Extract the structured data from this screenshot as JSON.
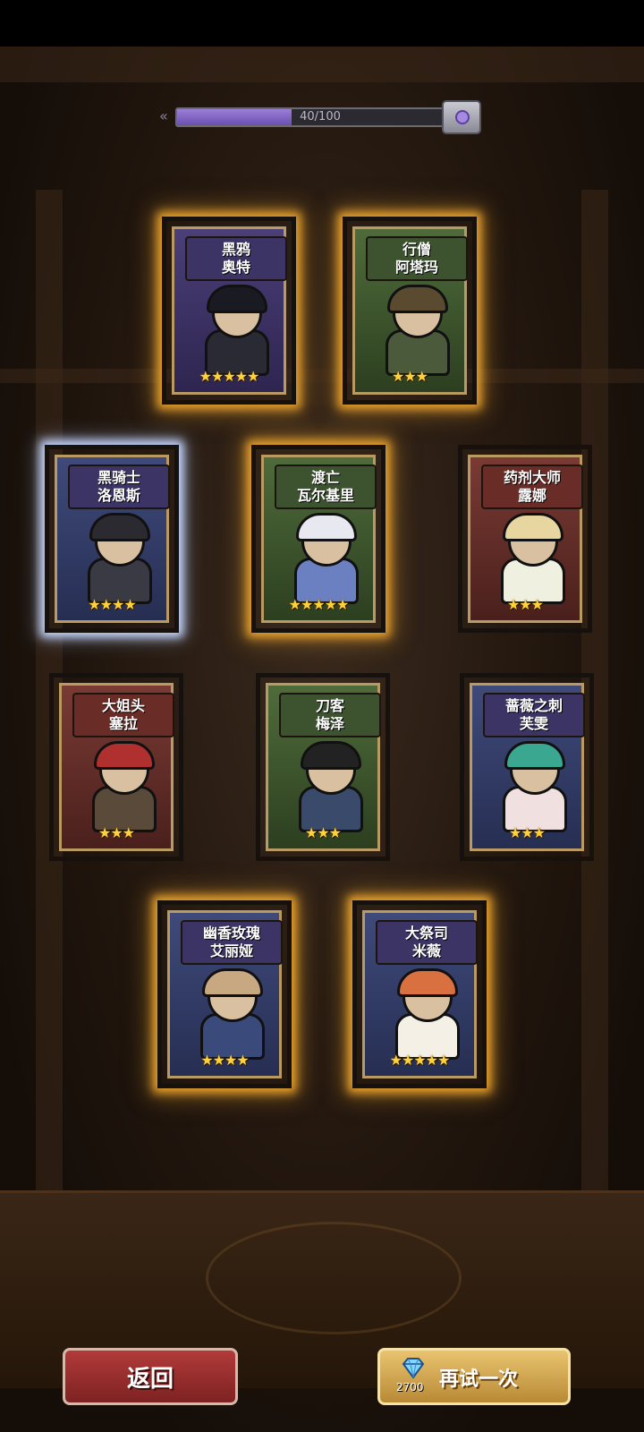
{
  "progress": {
    "current": 40,
    "max": 100,
    "fraction": 0.4,
    "text": "40/100",
    "end_icon": "treasure-chest-icon"
  },
  "cards": [
    {
      "key": "heiya",
      "line1": "黑鸦",
      "line2": "奥特",
      "stars": "★★★★★",
      "rarity": 5,
      "theme": "purple",
      "glow": "gold"
    },
    {
      "key": "xingseng",
      "line1": "行僧",
      "line2": "阿塔玛",
      "stars": "★★★",
      "rarity": 3,
      "theme": "green",
      "glow": "gold"
    },
    {
      "key": "heiqishi",
      "line1": "黑骑士",
      "line2": "洛恩斯",
      "stars": "★★★★",
      "rarity": 4,
      "theme": "blue",
      "glow": "blue"
    },
    {
      "key": "duwang",
      "line1": "渡亡",
      "line2": "瓦尔基里",
      "stars": "★★★★★",
      "rarity": 5,
      "theme": "green",
      "glow": "gold"
    },
    {
      "key": "yaoji",
      "line1": "药剂大师",
      "line2": "露娜",
      "stars": "★★★",
      "rarity": 3,
      "theme": "red",
      "glow": "none"
    },
    {
      "key": "dajietou",
      "line1": "大姐头",
      "line2": "塞拉",
      "stars": "★★★",
      "rarity": 3,
      "theme": "red",
      "glow": "none"
    },
    {
      "key": "daoke",
      "line1": "刀客",
      "line2": "梅泽",
      "stars": "★★★",
      "rarity": 3,
      "theme": "green",
      "glow": "none"
    },
    {
      "key": "qiangwei",
      "line1": "蔷薇之刺",
      "line2": "芙雯",
      "stars": "★★★",
      "rarity": 3,
      "theme": "blue",
      "glow": "none"
    },
    {
      "key": "youxiang",
      "line1": "幽香玫瑰",
      "line2": "艾丽娅",
      "stars": "★★★★",
      "rarity": 4,
      "theme": "blue",
      "glow": "gold"
    },
    {
      "key": "dajisi",
      "line1": "大祭司",
      "line2": "米薇",
      "stars": "★★★★★",
      "rarity": 5,
      "theme": "blue",
      "glow": "gold"
    }
  ],
  "buttons": {
    "back_label": "返回",
    "retry_label": "再试一次",
    "retry_cost": "2700",
    "cost_icon": "diamond-icon"
  },
  "colors": {
    "gold_glow": "#e8a12d",
    "blue_glow": "#c8d9ff",
    "star": "#ffd23a",
    "progress_fill": "#7a5fc0"
  }
}
